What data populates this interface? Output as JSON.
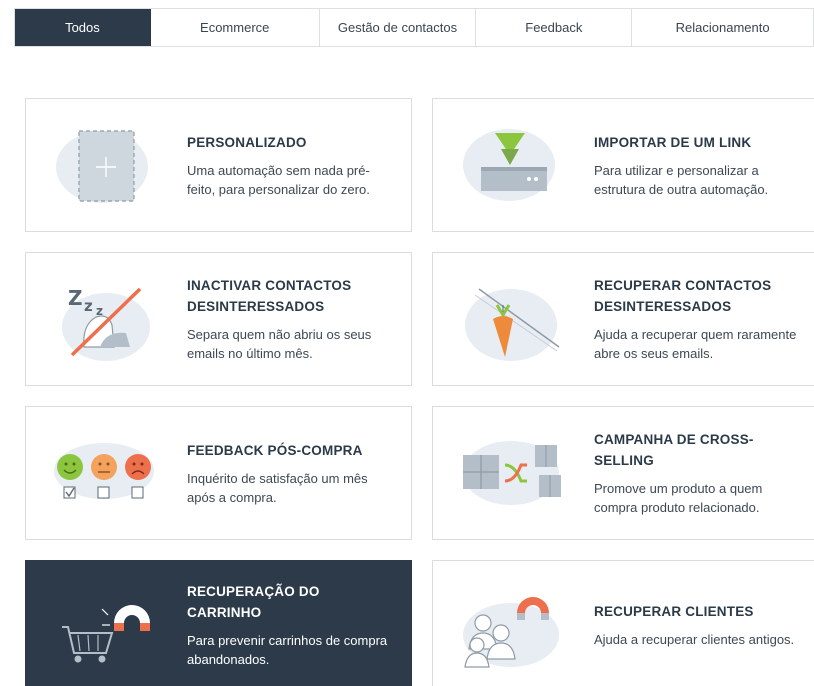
{
  "tabs": [
    {
      "label": "Todos",
      "active": true
    },
    {
      "label": "Ecommerce",
      "active": false
    },
    {
      "label": "Gestão de contactos",
      "active": false
    },
    {
      "label": "Feedback",
      "active": false
    },
    {
      "label": "Relacionamento",
      "active": false
    }
  ],
  "cards": [
    {
      "title": "PERSONALIZADO",
      "description": "Uma automação sem nada pré-feito, para personalizar do zero.",
      "icon": "blank-canvas-icon"
    },
    {
      "title": "IMPORTAR DE UM LINK",
      "description": "Para utilizar e personalizar a estrutura de outra automação.",
      "icon": "import-link-icon"
    },
    {
      "title": "INACTIVAR CONTACTOS DESINTERESSADOS",
      "description": "Separa quem não abriu os seus emails no último mês.",
      "icon": "sleeping-contact-icon"
    },
    {
      "title": "RECUPERAR CONTACTOS DESINTERESSADOS",
      "description": "Ajuda a recuperar quem raramente abre os seus emails.",
      "icon": "carrot-on-stick-icon"
    },
    {
      "title": "FEEDBACK PÓS-COMPRA",
      "description": "Inquérito de satisfação um mês após a compra.",
      "icon": "satisfaction-faces-icon"
    },
    {
      "title": "CAMPANHA DE CROSS-SELLING",
      "description": "Promove um produto a quem compra produto relacionado.",
      "icon": "cross-selling-icon"
    },
    {
      "title": "RECUPERAÇÃO DO CARRINHO",
      "description": "Para prevenir carrinhos de compra abandonados.",
      "icon": "cart-magnet-icon",
      "selected": true
    },
    {
      "title": "RECUPERAR CLIENTES",
      "description": "Ajuda a recuperar clientes antigos.",
      "icon": "customers-magnet-icon"
    }
  ],
  "colors": {
    "accent_dark": "#2c3a49",
    "highlight": "#ee6f4b",
    "green": "#8cc63f",
    "blob": "#e7edf2"
  }
}
